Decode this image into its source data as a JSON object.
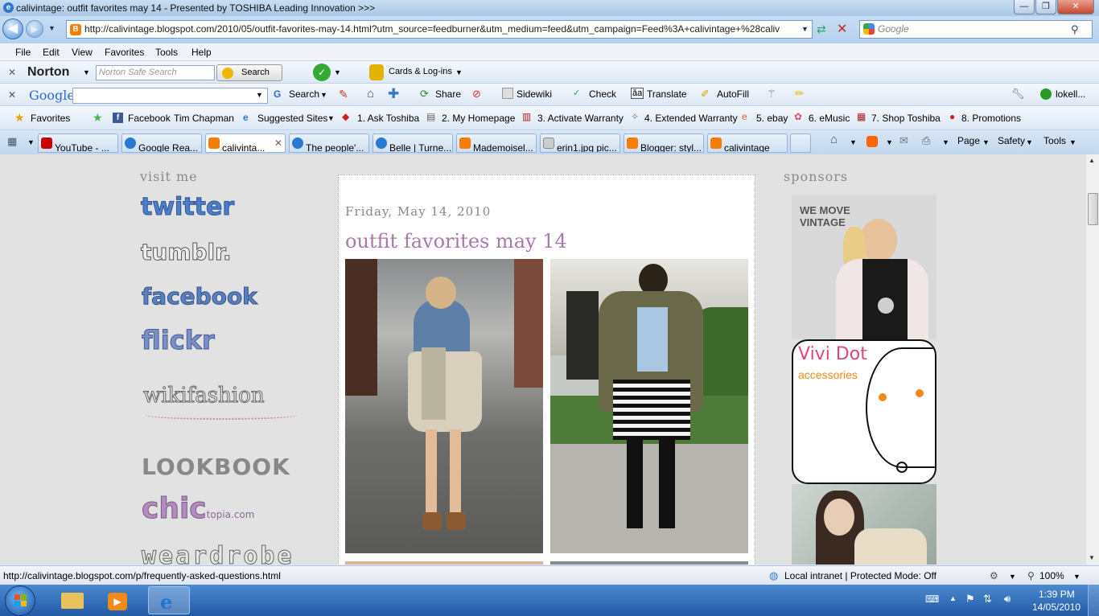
{
  "window": {
    "title": "calivintage: outfit favorites may 14 - Presented by TOSHIBA Leading Innovation >>>"
  },
  "address": {
    "url": "http://calivintage.blogspot.com/2010/05/outfit-favorites-may-14.html?utm_source=feedburner&utm_medium=feed&utm_campaign=Feed%3A+calivintage+%28caliv",
    "search_placeholder": "Google"
  },
  "menu": [
    "File",
    "Edit",
    "View",
    "Favorites",
    "Tools",
    "Help"
  ],
  "norton": {
    "logo": "Norton",
    "search_placeholder": "Norton Safe Search",
    "search_btn": "Search",
    "cards": "Cards & Log-ins"
  },
  "google_toolbar": {
    "logo": "Google",
    "items": [
      "Search",
      "Share",
      "Sidewiki",
      "Check",
      "Translate",
      "AutoFill"
    ],
    "user": "lokell..."
  },
  "favorites_bar": {
    "favorites": "Favorites",
    "items": [
      "Facebook",
      "Tim Chapman",
      "Suggested Sites",
      "1. Ask Toshiba",
      "2. My Homepage",
      "3. Activate Warranty",
      "4. Extended Warranty",
      "5. ebay",
      "6. eMusic",
      "7. Shop Toshiba",
      "8. Promotions"
    ]
  },
  "tabs": [
    "YouTube - ...",
    "Google Rea...",
    "calivinta...",
    "The people'...",
    "Belle | Turne...",
    "Mademoisel...",
    "erin1.jpg pic...",
    "Blogger: styl...",
    "calivintage"
  ],
  "command_bar": {
    "page": "Page",
    "safety": "Safety",
    "tools": "Tools"
  },
  "page": {
    "left_heading": "visit me",
    "social": [
      "twitter",
      "tumblr.",
      "facebook",
      "flickr",
      "wikifashion",
      "LOOKBOOK",
      "chic",
      "topia.com",
      "weardrobe"
    ],
    "right_heading": "sponsors",
    "sponsor1_text": "WE MOVE VINTAGE",
    "sponsor2_title": "Vivi Dot",
    "sponsor2_sub": "accessories",
    "post": {
      "date": "Friday, May 14, 2010",
      "title": "outfit favorites may 14"
    }
  },
  "status": {
    "link": "http://calivintage.blogspot.com/p/frequently-asked-questions.html",
    "zone": "Local intranet | Protected Mode: Off",
    "zoom": "100%"
  },
  "taskbar": {
    "time": "1:39 PM",
    "date": "14/05/2010"
  }
}
